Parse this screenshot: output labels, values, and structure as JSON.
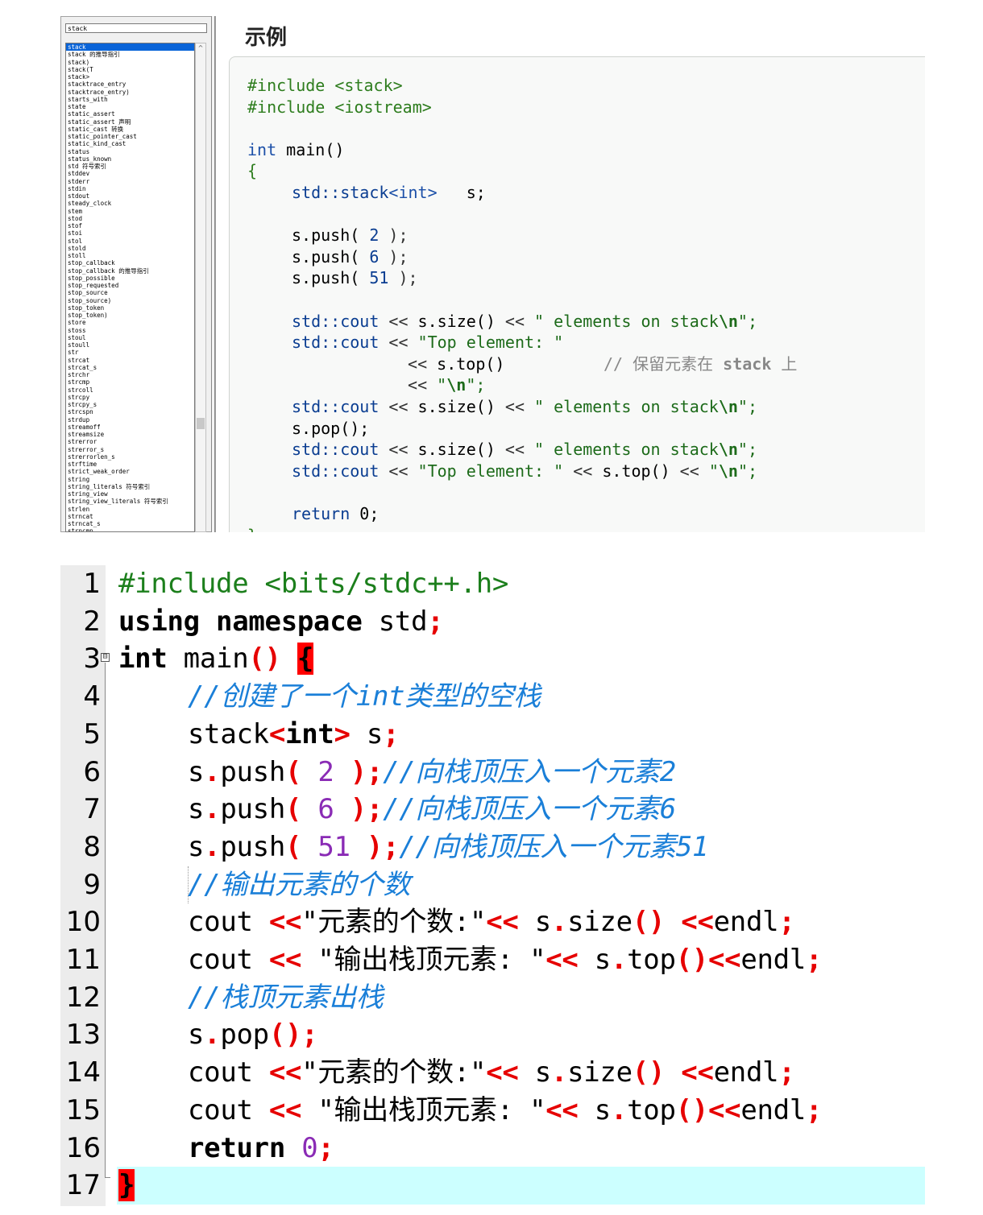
{
  "index": {
    "search_value": "stack",
    "items": [
      "stack",
      "stack 的推导指引",
      "stack)",
      "stack(T",
      "stack>",
      "stacktrace_entry",
      "stacktrace_entry)",
      "starts_with",
      "state",
      "static_assert",
      "static_assert 声明",
      "static_cast 转换",
      "static_pointer_cast",
      "static_kind_cast",
      "status",
      "status_known",
      "std 符号索引",
      "stddev",
      "stderr",
      "stdin",
      "stdout",
      "steady_clock",
      "stem",
      "stod",
      "stof",
      "stoi",
      "stol",
      "stold",
      "stoll",
      "stop_callback",
      "stop_callback 的推导指引",
      "stop_possible",
      "stop_requested",
      "stop_source",
      "stop_source)",
      "stop_token",
      "stop_token)",
      "store",
      "stoss",
      "stoul",
      "stoull",
      "str",
      "strcat",
      "strcat_s",
      "strchr",
      "strcmp",
      "strcoll",
      "strcpy",
      "strcpy_s",
      "strcspn",
      "strdup",
      "streamoff",
      "streamsize",
      "strerror",
      "strerror_s",
      "strerrorlen_s",
      "strftime",
      "strict_weak_order",
      "string",
      "string_literals 符号索引",
      "string_view",
      "string_view_literals 符号索引",
      "strlen",
      "strncat",
      "strncat_s",
      "strncmp"
    ],
    "selected_index": 0,
    "scroll_up_glyph": "^"
  },
  "example": {
    "heading": "示例",
    "tokens": {
      "include1": "#include <stack>",
      "include2": "#include <iostream>",
      "int": "int",
      "main_sig": " main()",
      "open_brace": "{",
      "std_stack": "std::stack",
      "tpl_int": "<int>",
      "var_s": "   s;",
      "push": "s.push(",
      "n2": " 2 ",
      "n6": " 6 ",
      "n51": " 51 ",
      "close_paren_semi": ");",
      "std_cout": "std::cout",
      "shl": " << ",
      "s_size": "s.size()",
      "s_top": "s.top()",
      "s_pop": "s.pop();",
      "str_elements": "\" elements on stack",
      "esc_n": "\\n",
      "str_close": "\";",
      "str_top_elem": "\"Top element: \"",
      "str_quote_open": "\"",
      "comment_prefix": "// 保留元素在 ",
      "comment_stack": "stack",
      "comment_suffix": " 上",
      "return": "return",
      "zero_semi": " 0;",
      "close_brace": "}"
    }
  },
  "editor": {
    "line_numbers": [
      "1",
      "2",
      "3",
      "4",
      "5",
      "6",
      "7",
      "8",
      "9",
      "10",
      "11",
      "12",
      "13",
      "14",
      "15",
      "16",
      "17"
    ],
    "fold_glyph": "⊟",
    "tokens": {
      "include": "#include <bits/stdc++.h>",
      "using": "using",
      "namespace": "namespace",
      "std": " std",
      "semi": ";",
      "int": "int",
      "main": " main",
      "parens": "()",
      "open_brace": "{",
      "close_brace": "}",
      "c_create": "//创建了一个int类型的空栈",
      "stack": "stack",
      "lt": "<",
      "gt": ">",
      "s_semi_var": " s",
      "s": "s",
      "dot": ".",
      "push": "push",
      "lparen": "(",
      "rparen_semi": ");",
      "n2": " 2 ",
      "n6": " 6 ",
      "n51": " 51 ",
      "c_push2": "//向栈顶压入一个元素2",
      "c_push6": "//向栈顶压入一个元素6",
      "c_push51": "//向栈顶压入一个元素51",
      "c_count": "//输出元素的个数",
      "cout": "cout ",
      "shl": "<<",
      "str_count": "\"元素的个数:\"",
      "size": "size",
      "endl": "endl",
      "str_top": " \"输出栈顶元素: \"",
      "top": "top",
      "c_pop": "//栈顶元素出栈",
      "pop": "pop",
      "ret": "return",
      "zero": "0",
      "sp": " "
    }
  }
}
